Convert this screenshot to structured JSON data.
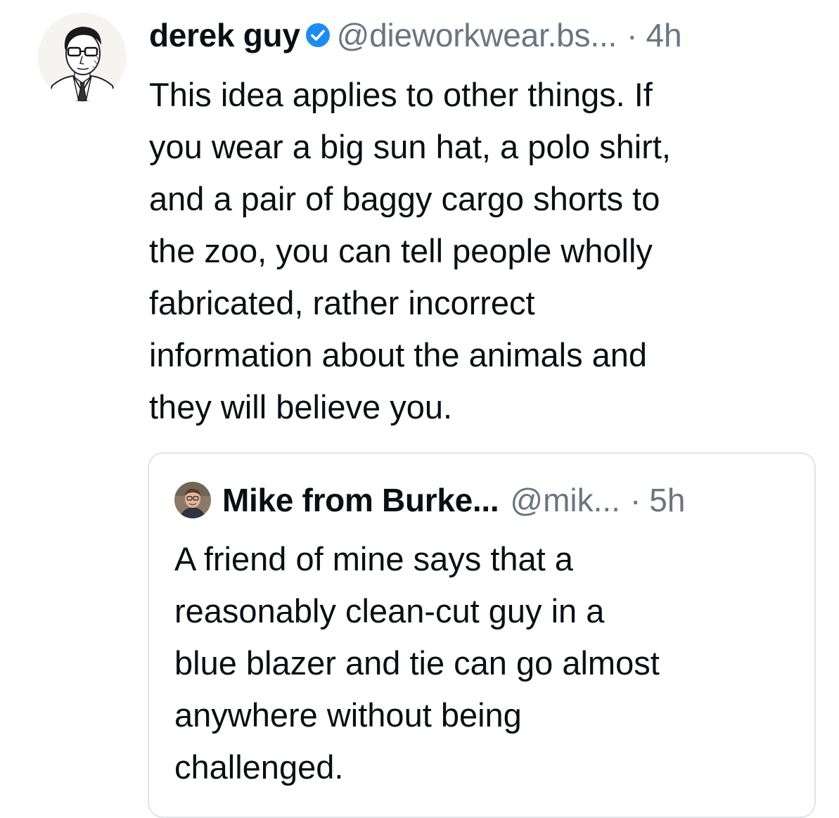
{
  "post": {
    "author": {
      "display_name": "derek guy",
      "handle": "@dieworkwear.bs...",
      "verified": true,
      "avatar_icon": "sketch-portrait-avatar"
    },
    "separator": "·",
    "time": "4h",
    "text_lines": [
      "This idea applies to other things. If",
      "you wear a big sun hat, a polo shirt,",
      "and a pair of baggy cargo shorts to",
      "the zoo, you can tell people wholly",
      "fabricated, rather incorrect",
      "information about the animals and",
      "they will believe you."
    ]
  },
  "quote": {
    "author": {
      "display_name": "Mike from Burke...",
      "handle": "@mik...",
      "avatar_icon": "photo-avatar"
    },
    "separator": "·",
    "time": "5h",
    "text_lines": [
      "A friend of mine says that a",
      "reasonably clean-cut guy in a",
      "blue blazer and tie can go almost",
      "anywhere without being",
      "challenged."
    ]
  },
  "colors": {
    "text": "#0b0f14",
    "secondary_text": "#6b7580",
    "verified_badge": "#1d8cf0",
    "quote_border": "#dfe4e8"
  }
}
